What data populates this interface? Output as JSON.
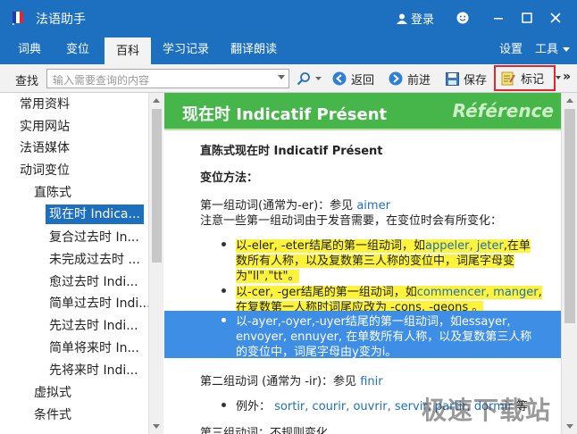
{
  "app": {
    "title": "法语助手",
    "login": "登录"
  },
  "menu": {
    "tabs": [
      "词典",
      "变位",
      "百科",
      "学习记录",
      "翻译朗读"
    ],
    "right": [
      "设置",
      "工具"
    ]
  },
  "toolbar": {
    "find_label": "查找",
    "search_placeholder": "输入需要查询的内容",
    "back": "返回",
    "forward": "前进",
    "save": "保存",
    "mark": "标记"
  },
  "sidebar": {
    "items": [
      "常用资料",
      "实用网站",
      "法语媒体",
      "动词变位",
      "直陈式",
      "现在时 Indica...",
      "复合过去时 In...",
      "未完成过去时 ...",
      "愈过去时 Indi...",
      "简单过去时 Indi...",
      "先过去时 Indi...",
      "简单将来时 In...",
      "先将来时 Indi...",
      "虚拟式",
      "条件式"
    ]
  },
  "content": {
    "banner_title": "现在时 Indicatif Présent",
    "banner_ref": "Référence",
    "heading": "直陈式现在时 Indicatif Présent",
    "method": "变位方法：",
    "g1_prefix": "第一组动词(通常为-er)：参见",
    "g1_link": "aimer",
    "g1_note": "注意一些第一组动词由于发音需要，在变位时会有所变化：",
    "b1_l1a": "以-eler, -eter结尾的第一组动词，如",
    "b1_l1b": "appeler, jeter",
    "b1_l1c": ",在单",
    "b1_l2": "数所有人称，以及复数第三人称的变位中，词尾字母变",
    "b1_l3": "为\"ll\",\"tt\"。",
    "b2_l1a": "以-cer, -ger结尾的第一组动词，如",
    "b2_l1b": "commencer, manger",
    "b2_l1c": ",",
    "b2_l2": "在复数第一人称时词尾应改为 -çons, -geons 。",
    "b3_l1": "以-ayer,-oyer,-uyer结尾的第一组动词，如essayer,",
    "b3_l2": "envoyer, ennuyer, 在单数所有人称，以及复数第三人称",
    "b3_l3": "的变位中，词尾字母由y变为i。",
    "g2_prefix": "第二组动词 (通常为 -ir)：参见",
    "g2_link": "finir",
    "ex_label": "例外：",
    "ex_words": "sortir, courir, ouvrir, servir, partir, dormir",
    "ex_tail": "等",
    "g3_partial": "第三组动词：不规则变化"
  },
  "watermark": "极速下载站"
}
